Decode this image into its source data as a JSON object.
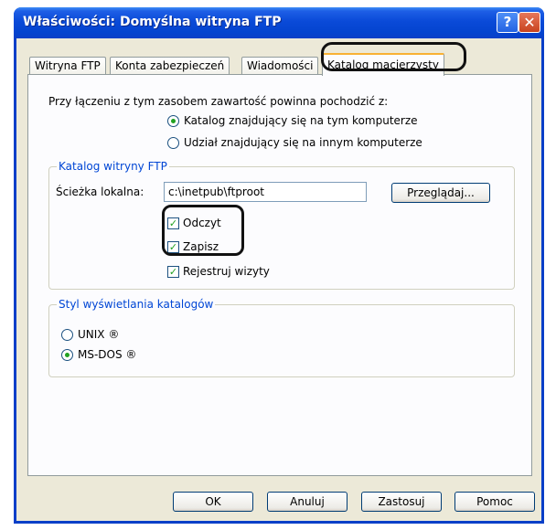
{
  "window": {
    "title": "Właściwości: Domyślna witryna FTP",
    "help_label": "?",
    "close_label": "✕"
  },
  "tabs": [
    {
      "label": "Witryna FTP"
    },
    {
      "label": "Konta zabezpieczeń"
    },
    {
      "label": "Wiadomości"
    },
    {
      "label": "Katalog macierzysty",
      "active": true
    }
  ],
  "content_source": {
    "label": "Przy łączeniu z tym zasobem zawartość powinna pochodzić z:",
    "options": [
      {
        "label": "Katalog znajdujący się na tym komputerze",
        "selected": true
      },
      {
        "label": "Udział znajdujący się na innym komputerze",
        "selected": false
      }
    ]
  },
  "ftp_dir": {
    "legend": "Katalog witryny FTP",
    "path_label": "Ścieżka lokalna:",
    "path_value": "c:\\inetpub\\ftproot",
    "browse_label": "Przeglądaj...",
    "checks": [
      {
        "label": "Odczyt",
        "checked": true
      },
      {
        "label": "Zapisz",
        "checked": true
      },
      {
        "label": "Rejestruj wizyty",
        "checked": true
      }
    ]
  },
  "listing_style": {
    "legend": "Styl wyświetlania katalogów",
    "options": [
      {
        "label": "UNIX ®",
        "selected": false
      },
      {
        "label": "MS-DOS ®",
        "selected": true
      }
    ]
  },
  "buttons": {
    "ok": "OK",
    "cancel": "Anuluj",
    "apply": "Zastosuj",
    "help": "Pomoc"
  },
  "colors": {
    "titlebar": "#0a4ad8",
    "dialog_bg": "#ece9d8",
    "group_legend": "#0046d5",
    "active_tab_accent": "#f8b134"
  }
}
